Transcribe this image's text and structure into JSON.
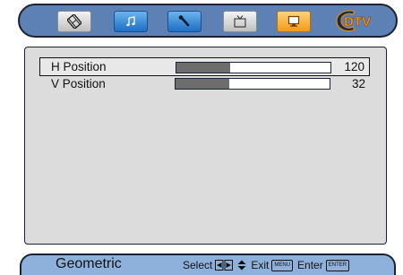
{
  "tabs": [
    {
      "icon": "film-icon",
      "style": "silver"
    },
    {
      "icon": "music-note-icon",
      "style": "blue"
    },
    {
      "icon": "wrench-icon",
      "style": "blue"
    },
    {
      "icon": "tv-icon",
      "style": "silver"
    },
    {
      "icon": "monitor-icon",
      "style": "orange"
    }
  ],
  "logo": {
    "text": "DTV",
    "icon": "dtv-logo"
  },
  "menu": {
    "items": [
      {
        "label": "H Position",
        "value": "120",
        "level": 0.35
      },
      {
        "label": "V Position",
        "value": "32",
        "level": 0.35
      }
    ]
  },
  "footer": {
    "title": "Geometric",
    "select_label": "Select",
    "exit_label": "Exit",
    "menu_key": "MENU",
    "enter_label": "Enter",
    "enter_key": "ENTER"
  },
  "colors": {
    "bar_fill": "#6d6d6d",
    "top_bar": "#5d80b5",
    "bottom_bar": "#8eb1dc",
    "panel": "#dcdcdc",
    "active_tab": "#f29a16"
  }
}
